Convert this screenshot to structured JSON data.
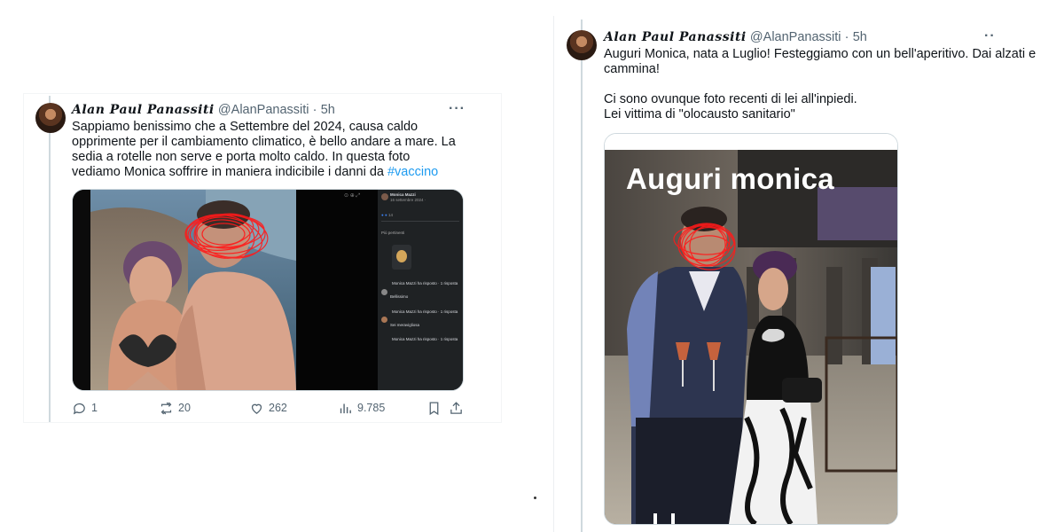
{
  "left_tweet": {
    "display_name": "Alan Paul Panassiti",
    "handle": "@AlanPanassiti",
    "separator": "·",
    "time": "5h",
    "more": "···",
    "text_plain": "Sappiamo benissimo che a Settembre del 2024, causa caldo opprimente per il cambiamento climatico, è bello andare a mare. La sedia a rotelle non serve e porta molto caldo. In questa foto vediamo Monica soffrire in maniera indicibile i danni da ",
    "hashtag": "#vaccino",
    "replies": "1",
    "retweets": "20",
    "likes": "262",
    "views": "9.785",
    "media": {
      "fb_post_name": "Monica Mazzi",
      "fb_date": "16 settembre 2024 ·",
      "fb_filter": "Più pertinenti",
      "fb_comment_1": "Bellissimo",
      "fb_comment_2": "Sei meravigliosa",
      "fb_reply_1": "Monica Mazzi ha risposto · 1 risposta",
      "fb_reply_2": "Monica Mazzi ha risposto · 1 risposta",
      "fb_reply_3": "Monica Mazzi ha risposto · 1 risposta"
    }
  },
  "right_tweet": {
    "display_name": "Alan Paul Panassiti",
    "handle": "@AlanPanassiti",
    "separator": "·",
    "time": "5h",
    "more": "··",
    "line1": "Auguri Monica, nata a Luglio! Festeggiamo con un bell'aperitivo. Dai alzati e",
    "line2": "cammina!",
    "line3": "Ci sono ovunque foto recenti di lei all'inpiedi.",
    "line4": "Lei vittima di \"olocausto sanitario\"",
    "media": {
      "overlay_text": "Auguri monica"
    }
  },
  "colors": {
    "text": "#0f1419",
    "secondary": "#536471",
    "link": "#1d9bf0",
    "border": "#cfd9de",
    "scribble": "#ff1a1a"
  }
}
